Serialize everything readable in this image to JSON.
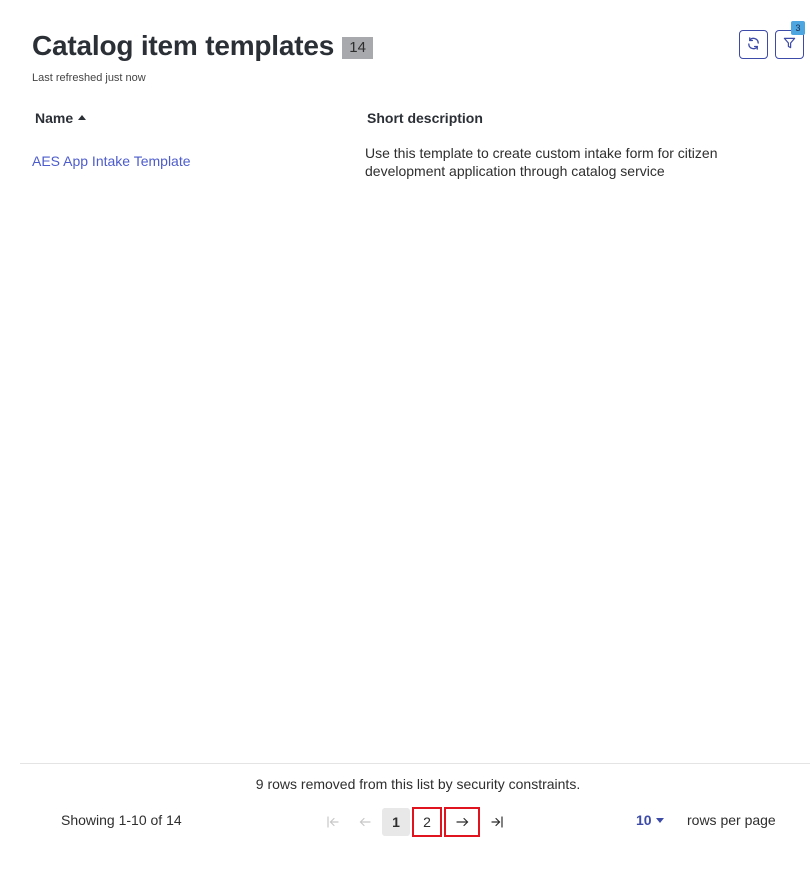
{
  "header": {
    "title": "Catalog item templates",
    "count": "14",
    "last_refreshed": "Last refreshed just now",
    "filter_count": "3",
    "refresh_icon": "refresh-icon",
    "filter_icon": "filter-icon"
  },
  "table": {
    "columns": [
      "Name",
      "Short description"
    ],
    "sort": {
      "column": "Name",
      "direction": "asc"
    },
    "rows": [
      {
        "name": "AES App Intake Template",
        "short_description": "Use this template to create custom intake form for citizen development application through catalog service"
      }
    ]
  },
  "footer": {
    "security_message": "9 rows removed from this list by security constraints.",
    "showing": "Showing 1-10 of 14",
    "pages": [
      "1",
      "2"
    ],
    "current_page": "1",
    "rows_per_page_value": "10",
    "rows_per_page_label": "rows per page"
  },
  "colors": {
    "link": "#4d5ccc",
    "accent": "#3d4ba8",
    "badge": "#a7a9ad",
    "filter_badge": "#4da6e0",
    "highlight_box": "#e0141e"
  }
}
